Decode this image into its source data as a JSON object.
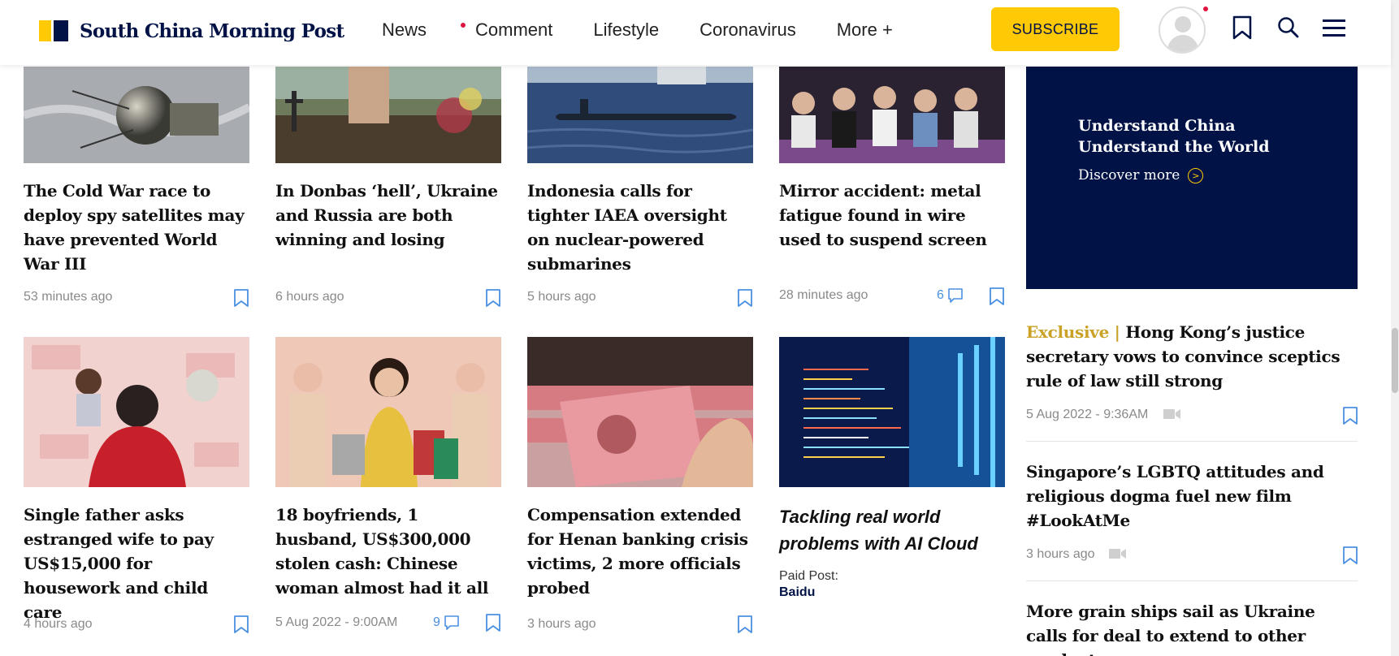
{
  "header": {
    "logo_text": "South China Morning Post",
    "nav": [
      "News",
      "Comment",
      "Lifestyle",
      "Coronavirus",
      "More +"
    ],
    "subscribe_label": "SUBSCRIBE",
    "icons": [
      "avatar-icon",
      "bookmark-icon",
      "search-icon",
      "menu-icon"
    ]
  },
  "colors": {
    "brand_navy": "#001246",
    "brand_yellow": "#FFCA05",
    "alert_red": "#E0153F",
    "exclusive_gold": "#C9A227",
    "comment_blue": "#4a90e2"
  },
  "articles_row1": [
    {
      "title": "The Cold War race to deploy spy satellites may have prevented World War III",
      "time": "53 minutes ago",
      "comments": ""
    },
    {
      "title": "In Donbas ‘hell’, Ukraine and Russia are both winning and losing",
      "time": "6 hours ago",
      "comments": ""
    },
    {
      "title": "Indonesia calls for tighter IAEA oversight on nuclear-powered submarines",
      "time": "5 hours ago",
      "comments": ""
    },
    {
      "title": "Mirror accident: metal fatigue found in wire used to suspend screen",
      "time": "28 minutes ago",
      "comments": "6"
    }
  ],
  "articles_row2": [
    {
      "title": "Single father asks estranged wife to pay US$15,000 for housework and child care",
      "time": "4 hours ago",
      "comments": ""
    },
    {
      "title": "18 boyfriends, 1 husband, US$300,000 stolen cash: Chinese woman almost had it all",
      "time": "5 Aug 2022 - 9:00AM",
      "comments": "9"
    },
    {
      "title": "Compensation extended for Henan banking crisis victims, 2 more officials probed",
      "time": "3 hours ago",
      "comments": ""
    }
  ],
  "paid_post": {
    "title": "Tackling real world problems with AI Cloud",
    "label": "Paid Post:",
    "brand": "Baidu"
  },
  "promo": {
    "line1": "Understand China",
    "line2": "Understand the World",
    "link": "Discover more"
  },
  "rail": [
    {
      "tag": "Exclusive |",
      "title": "Hong Kong’s justice secretary vows to convince sceptics rule of law still strong",
      "time": "5 Aug 2022 - 9:36AM"
    },
    {
      "tag": "",
      "title": "Singapore’s LGBTQ attitudes and religious dogma fuel new film #LookAtMe",
      "time": "3 hours ago"
    },
    {
      "tag": "",
      "title": "More grain ships sail as Ukraine calls for deal to extend to other products",
      "time": ""
    }
  ]
}
